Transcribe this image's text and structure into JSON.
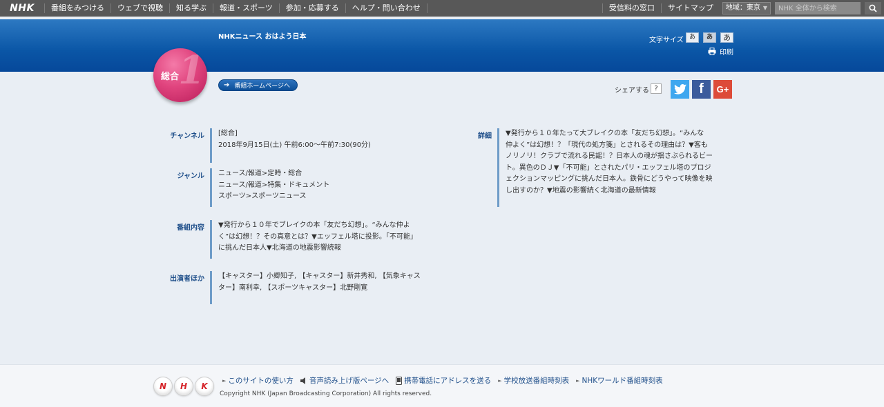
{
  "topnav": {
    "logo": "NHK",
    "items": [
      "番組をみつける",
      "ウェブで視聴",
      "知る学ぶ",
      "報道・スポーツ",
      "参加・応募する",
      "ヘルプ・問い合わせ"
    ],
    "right_items": [
      "受信料の窓口",
      "サイトマップ"
    ],
    "region": "地域：東京",
    "search_placeholder": "NHK 全体から検索"
  },
  "header": {
    "program_title": "NHKニュース おはよう日本",
    "font_size_label": "文字サイズ",
    "font_size_options": [
      "あ",
      "あ",
      "あ"
    ],
    "print_label": "印刷"
  },
  "channel_badge": {
    "label": "総合",
    "number": "1"
  },
  "home_button_label": "番組ホームページへ",
  "share": {
    "label": "シェアする",
    "help": "?"
  },
  "info": {
    "channel": {
      "label": "チャンネル",
      "lines": [
        "[総合]",
        "2018年9月15日(土) 午前6:00〜午前7:30(90分)"
      ]
    },
    "genre": {
      "label": "ジャンル",
      "lines": [
        "ニュース/報道>定時・総合",
        "ニュース/報道>特集・ドキュメント",
        "スポーツ>スポーツニュース"
      ]
    },
    "content": {
      "label": "番組内容",
      "lines": [
        "▼発行から１０年でブレイクの本「友だち幻想」。“みんな仲よ",
        "く”は幻想！？その真意とは？▼エッフェル塔に投影。「不可能」",
        "に挑んだ日本人▼北海道の地震影響続報"
      ]
    },
    "cast": {
      "label": "出演者ほか",
      "lines": [
        "【キャスター】小郷知子, 【キャスター】新井秀和, 【気象キャス",
        "ター】南利幸, 【スポーツキャスター】北野剛寛"
      ]
    },
    "details": {
      "label": "詳細",
      "lines": [
        "▼発行から１０年たって大ブレイクの本「友だち幻想」。“みんな",
        "仲よく”は幻想！？「現代の処方箋」とされるその理由は？▼客も",
        "ノリノリ！クラブで流れる民謡！？日本人の魂が揺さぶられるビー",
        "ト。異色のＤＪ▼「不可能」とされたパリ・エッフェル塔のプロジ",
        "ェクションマッピングに挑んだ日本人。鉄骨にどうやって映像を映",
        "し出すのか？▼地震の影響続く北海道の最新情報"
      ]
    }
  },
  "footer": {
    "logo_letters": [
      "N",
      "H",
      "K"
    ],
    "links": [
      "このサイトの使い方",
      "音声読み上げ版ページへ",
      "携帯電話にアドレスを送る",
      "学校放送番組時刻表",
      "NHKワールド番組時刻表"
    ],
    "copyright": "Copyright NHK (Japan Broadcasting Corporation) All rights reserved."
  },
  "colors": {
    "header_blue": "#0a56a6",
    "channel_pink": "#e0447e",
    "label_blue": "#1f4f8a",
    "twitter": "#3fa7ef",
    "facebook": "#3b5b9c",
    "googleplus": "#dd4b39"
  }
}
